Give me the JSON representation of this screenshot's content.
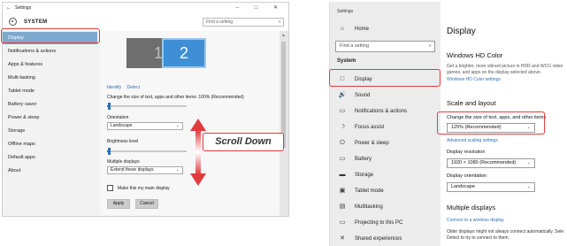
{
  "left": {
    "window_title": "Settings",
    "back_glyph": "←",
    "window_controls": "–  □  ✕",
    "header": "SYSTEM",
    "search_placeholder": "Find a setting",
    "sidebar": [
      {
        "label": "Display",
        "active": true
      },
      {
        "label": "Notifications & actions"
      },
      {
        "label": "Apps & features"
      },
      {
        "label": "Multi-tasking"
      },
      {
        "label": "Tablet mode"
      },
      {
        "label": "Battery saver"
      },
      {
        "label": "Power & sleep"
      },
      {
        "label": "Storage"
      },
      {
        "label": "Offline maps"
      },
      {
        "label": "Default apps"
      },
      {
        "label": "About"
      }
    ],
    "monitor1": "1",
    "monitor2": "2",
    "identify": "Identify",
    "detect": "Detect",
    "scale_label": "Change the size of text, apps and other items: 100% (Recommended)",
    "scale_fraction": 0.02,
    "orientation_label": "Orientation",
    "orientation_value": "Landscape",
    "brightness_label": "Brightness level",
    "brightness_fraction": 0.02,
    "multiple_label": "Multiple displays",
    "multiple_value": "Extend these displays",
    "main_display": "Make this my main display",
    "apply": "Apply",
    "cancel": "Cancel"
  },
  "callout": "Scroll Down",
  "right": {
    "window_title": "Settings",
    "home": "Home",
    "search_placeholder": "Find a setting",
    "section": "System",
    "sidebar": [
      {
        "icon": "□",
        "icon_name": "monitor-icon",
        "label": "Display",
        "active": true
      },
      {
        "icon": "🔊",
        "icon_name": "speaker-icon",
        "label": "Sound"
      },
      {
        "icon": "▭",
        "icon_name": "notification-icon",
        "label": "Notifications & actions"
      },
      {
        "icon": "☽",
        "icon_name": "moon-icon",
        "label": "Focus assist"
      },
      {
        "icon": "⏻",
        "icon_name": "power-icon",
        "label": "Power & sleep"
      },
      {
        "icon": "▭",
        "icon_name": "battery-icon",
        "label": "Battery"
      },
      {
        "icon": "▬",
        "icon_name": "storage-icon",
        "label": "Storage"
      },
      {
        "icon": "▣",
        "icon_name": "tablet-icon",
        "label": "Tablet mode"
      },
      {
        "icon": "▤",
        "icon_name": "multitasking-icon",
        "label": "Multitasking"
      },
      {
        "icon": "▭",
        "icon_name": "projector-icon",
        "label": "Projecting to this PC"
      },
      {
        "icon": "✕",
        "icon_name": "shared-icon",
        "label": "Shared experiences"
      }
    ],
    "page_title": "Display",
    "hdr_title": "Windows HD Color",
    "hdr_desc_1": "Get a brighter, more vibrant picture in HDR and WCG video",
    "hdr_desc_2": "games, and apps on the display selected above.",
    "hdr_link": "Windows HD Color settings",
    "scale_title": "Scale and layout",
    "scale_label": "Change the size of text, apps, and other items",
    "scale_value": "125% (Recommended)",
    "advanced_link": "Advanced scaling settings",
    "resolution_label": "Display resolution",
    "resolution_value": "1920 × 1080 (Recommended)",
    "orientation_label": "Display orientation",
    "orientation_value": "Landscape",
    "multiple_title": "Multiple displays",
    "wireless_link": "Connect to a wireless display",
    "older_1": "Older displays might not always connect automatically. Sele",
    "older_2": "Detect to try to connect to them."
  }
}
